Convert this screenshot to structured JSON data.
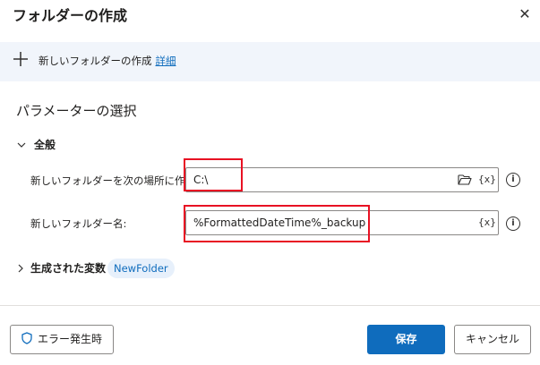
{
  "dialog": {
    "title": "フォルダーの作成",
    "close_glyph": "✕"
  },
  "banner": {
    "text": "新しいフォルダーの作成",
    "link": "詳細"
  },
  "section": {
    "title": "パラメーターの選択"
  },
  "general": {
    "label": "全般",
    "fields": {
      "location": {
        "label": "新しいフォルダーを次の場所に作成:",
        "value": "C:\\",
        "variable_button": "{x}"
      },
      "name": {
        "label": "新しいフォルダー名:",
        "value": "%FormattedDateTime%_backup",
        "variable_button": "{x}"
      }
    }
  },
  "variables": {
    "label": "生成された変数",
    "badge": "NewFolder"
  },
  "footer": {
    "on_error": "エラー発生時",
    "save": "保存",
    "cancel": "キャンセル"
  },
  "colors": {
    "accent": "#0f6cbd",
    "highlight_box": "#e81123",
    "banner_bg": "#f1f5fb"
  }
}
